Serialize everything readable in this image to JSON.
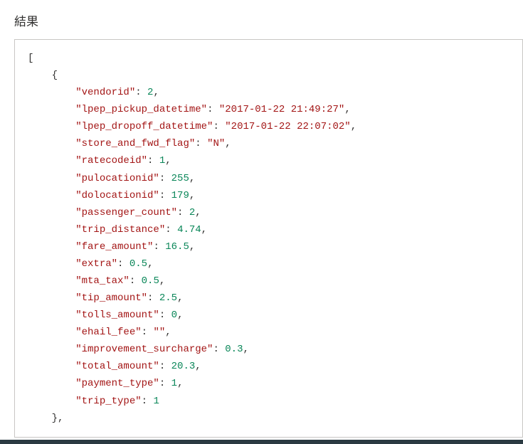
{
  "header": {
    "title": "結果"
  },
  "json_result": {
    "indent1": "[",
    "indent2": "    {",
    "fields": [
      {
        "key": "\"vendorid\"",
        "sep": ": ",
        "value": "2",
        "valueType": "number",
        "trail": ","
      },
      {
        "key": "\"lpep_pickup_datetime\"",
        "sep": ": ",
        "value": "\"2017-01-22 21:49:27\"",
        "valueType": "string",
        "trail": ","
      },
      {
        "key": "\"lpep_dropoff_datetime\"",
        "sep": ": ",
        "value": "\"2017-01-22 22:07:02\"",
        "valueType": "string",
        "trail": ","
      },
      {
        "key": "\"store_and_fwd_flag\"",
        "sep": ": ",
        "value": "\"N\"",
        "valueType": "string",
        "trail": ","
      },
      {
        "key": "\"ratecodeid\"",
        "sep": ": ",
        "value": "1",
        "valueType": "number",
        "trail": ","
      },
      {
        "key": "\"pulocationid\"",
        "sep": ": ",
        "value": "255",
        "valueType": "number",
        "trail": ","
      },
      {
        "key": "\"dolocationid\"",
        "sep": ": ",
        "value": "179",
        "valueType": "number",
        "trail": ","
      },
      {
        "key": "\"passenger_count\"",
        "sep": ": ",
        "value": "2",
        "valueType": "number",
        "trail": ","
      },
      {
        "key": "\"trip_distance\"",
        "sep": ": ",
        "value": "4.74",
        "valueType": "number",
        "trail": ","
      },
      {
        "key": "\"fare_amount\"",
        "sep": ": ",
        "value": "16.5",
        "valueType": "number",
        "trail": ","
      },
      {
        "key": "\"extra\"",
        "sep": ": ",
        "value": "0.5",
        "valueType": "number",
        "trail": ","
      },
      {
        "key": "\"mta_tax\"",
        "sep": ": ",
        "value": "0.5",
        "valueType": "number",
        "trail": ","
      },
      {
        "key": "\"tip_amount\"",
        "sep": ": ",
        "value": "2.5",
        "valueType": "number",
        "trail": ","
      },
      {
        "key": "\"tolls_amount\"",
        "sep": ": ",
        "value": "0",
        "valueType": "number",
        "trail": ","
      },
      {
        "key": "\"ehail_fee\"",
        "sep": ": ",
        "value": "\"\"",
        "valueType": "string",
        "trail": ","
      },
      {
        "key": "\"improvement_surcharge\"",
        "sep": ": ",
        "value": "0.3",
        "valueType": "number",
        "trail": ","
      },
      {
        "key": "\"total_amount\"",
        "sep": ": ",
        "value": "20.3",
        "valueType": "number",
        "trail": ","
      },
      {
        "key": "\"payment_type\"",
        "sep": ": ",
        "value": "1",
        "valueType": "number",
        "trail": ","
      },
      {
        "key": "\"trip_type\"",
        "sep": ": ",
        "value": "1",
        "valueType": "number",
        "trail": ""
      }
    ],
    "indent3": "    },",
    "field_indent": "        "
  }
}
